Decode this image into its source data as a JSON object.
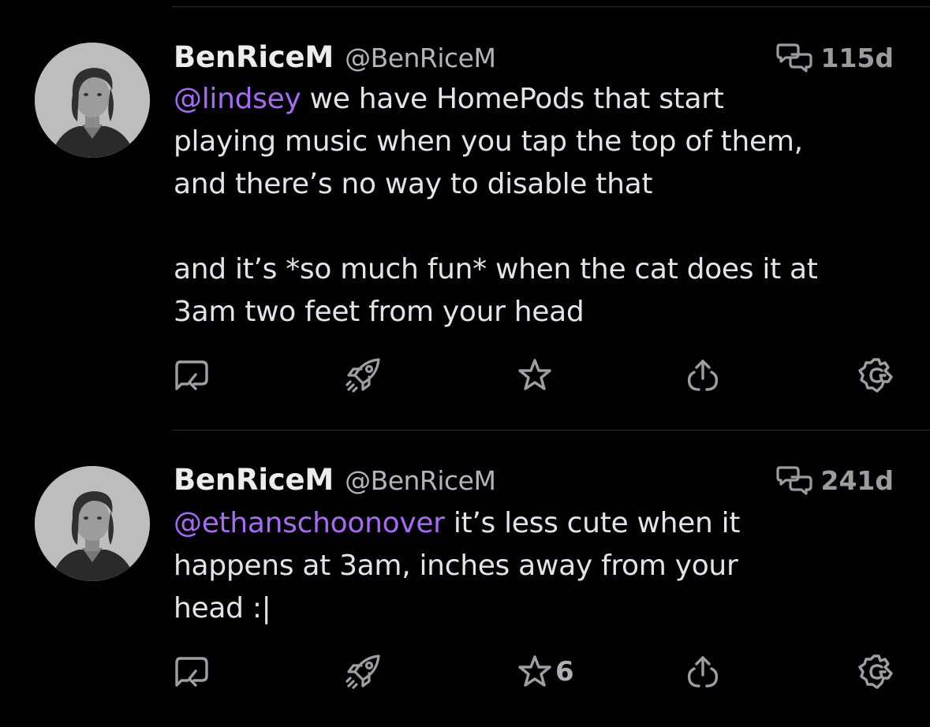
{
  "posts": [
    {
      "display_name": "BenRiceM",
      "handle": "@BenRiceM",
      "reply_indicator_icon": "conversation-bubbles-icon",
      "age": "115d",
      "mention": "@lindsey",
      "text": " we have HomePods that start\nplaying music when you tap the top of them,\nand there’s no way to disable that\n\nand it’s *so much fun* when the cat does it at\n3am two feet from your head",
      "favorite_count": ""
    },
    {
      "display_name": "BenRiceM",
      "handle": "@BenRiceM",
      "reply_indicator_icon": "conversation-bubbles-icon",
      "age": "241d",
      "mention": "@ethanschoonover",
      "text": " it’s less cute when it\nhappens at 3am, inches away from your\nhead :|",
      "favorite_count": "6"
    }
  ],
  "actions": [
    "reply-icon",
    "boost-rocket-icon",
    "favorite-star-icon",
    "share-icon",
    "more-gear-icon"
  ],
  "colors": {
    "background": "#000000",
    "mention": "#a46cf4",
    "text": "#e4e4e8",
    "secondary": "#9e9ea3"
  }
}
